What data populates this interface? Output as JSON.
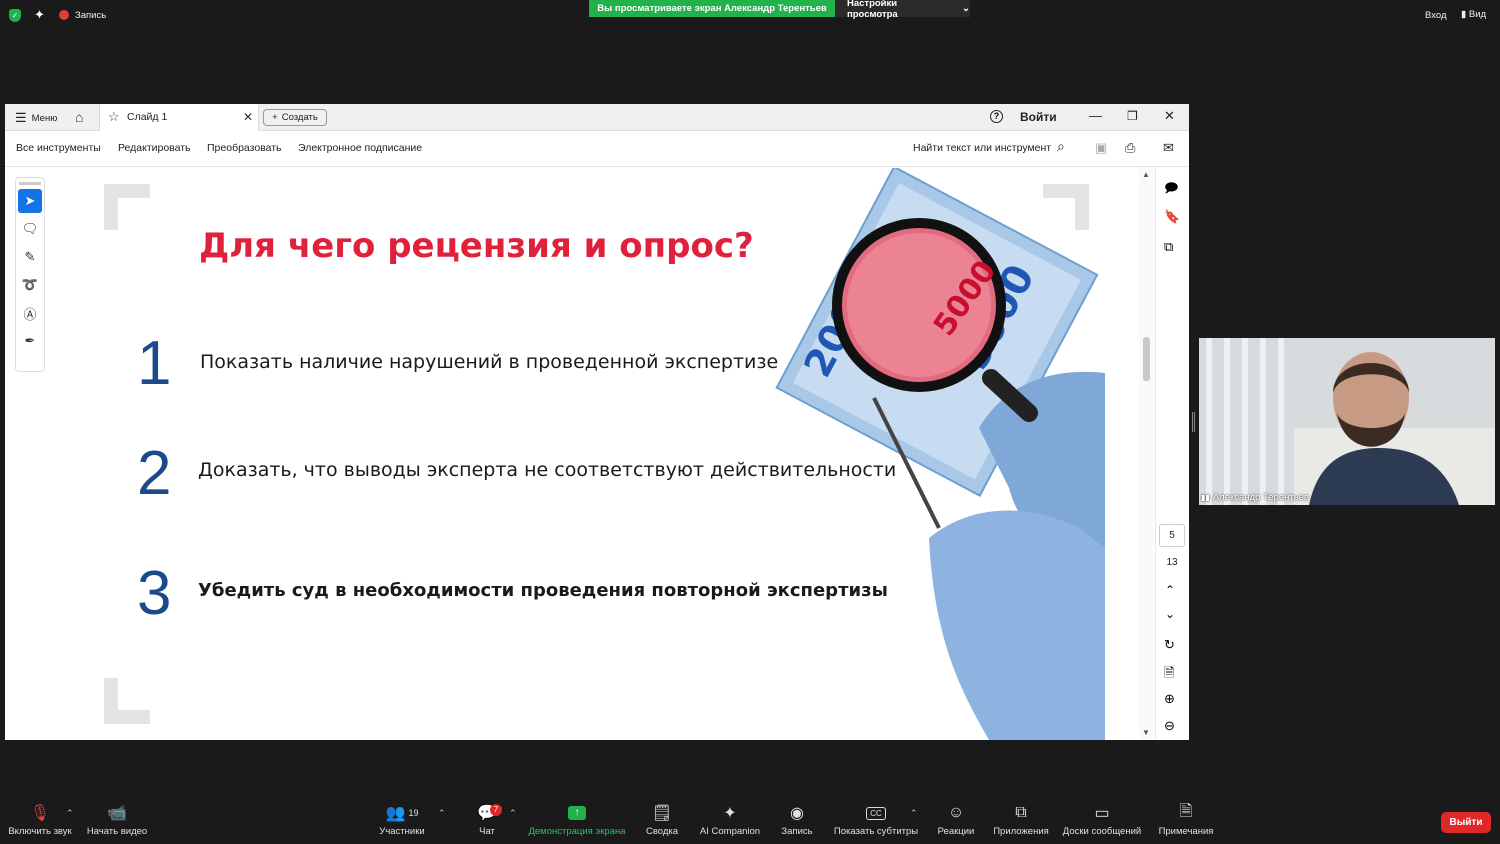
{
  "zoom_top": {
    "record_label": "Запись",
    "sharing_banner": "Вы просматриваете экран Александр Терентьев",
    "view_settings": "Настройки просмотра",
    "signin_label": "Вход",
    "view_label": "Вид"
  },
  "acrobat": {
    "menu_label": "Меню",
    "tab_label": "Слайд 1",
    "create_label": "Создать",
    "signin_label": "Войти",
    "menus": [
      "Все инструменты",
      "Редактировать",
      "Преобразовать",
      "Электронное подписание"
    ],
    "search_label": "Найти текст или инструмент",
    "page_current": "5",
    "page_total": "13"
  },
  "slide": {
    "title": "Для чего рецензия и опрос?",
    "points": [
      {
        "number": "1",
        "text": "Показать наличие нарушений в проведенной экспертизе"
      },
      {
        "number": "2",
        "text": "Доказать, что выводы эксперта не соответствуют действительности"
      },
      {
        "number": "3",
        "text": "Убедить суд в необходимости проведения повторной экспертизы"
      }
    ],
    "banknote_text": "5000",
    "banknote_text2": "200"
  },
  "video": {
    "participant_name": "Александр Терентьев"
  },
  "zoom_bottom": {
    "unmute": "Включить звук",
    "start_video": "Начать видео",
    "participants": "Участники",
    "participants_count": "19",
    "chat": "Чат",
    "chat_badge": "7",
    "share": "Демонстрация экрана",
    "summary": "Сводка",
    "ai": "AI Companion",
    "record": "Запись",
    "captions": "Показать субтитры",
    "reactions": "Реакции",
    "apps": "Приложения",
    "whiteboards": "Доски сообщений",
    "notes": "Примечания",
    "leave": "Выйти"
  },
  "colors": {
    "accent_red": "#e0213c",
    "number_blue": "#1a4a8a",
    "zoom_green": "#22b24c",
    "leave_red": "#e02828"
  }
}
